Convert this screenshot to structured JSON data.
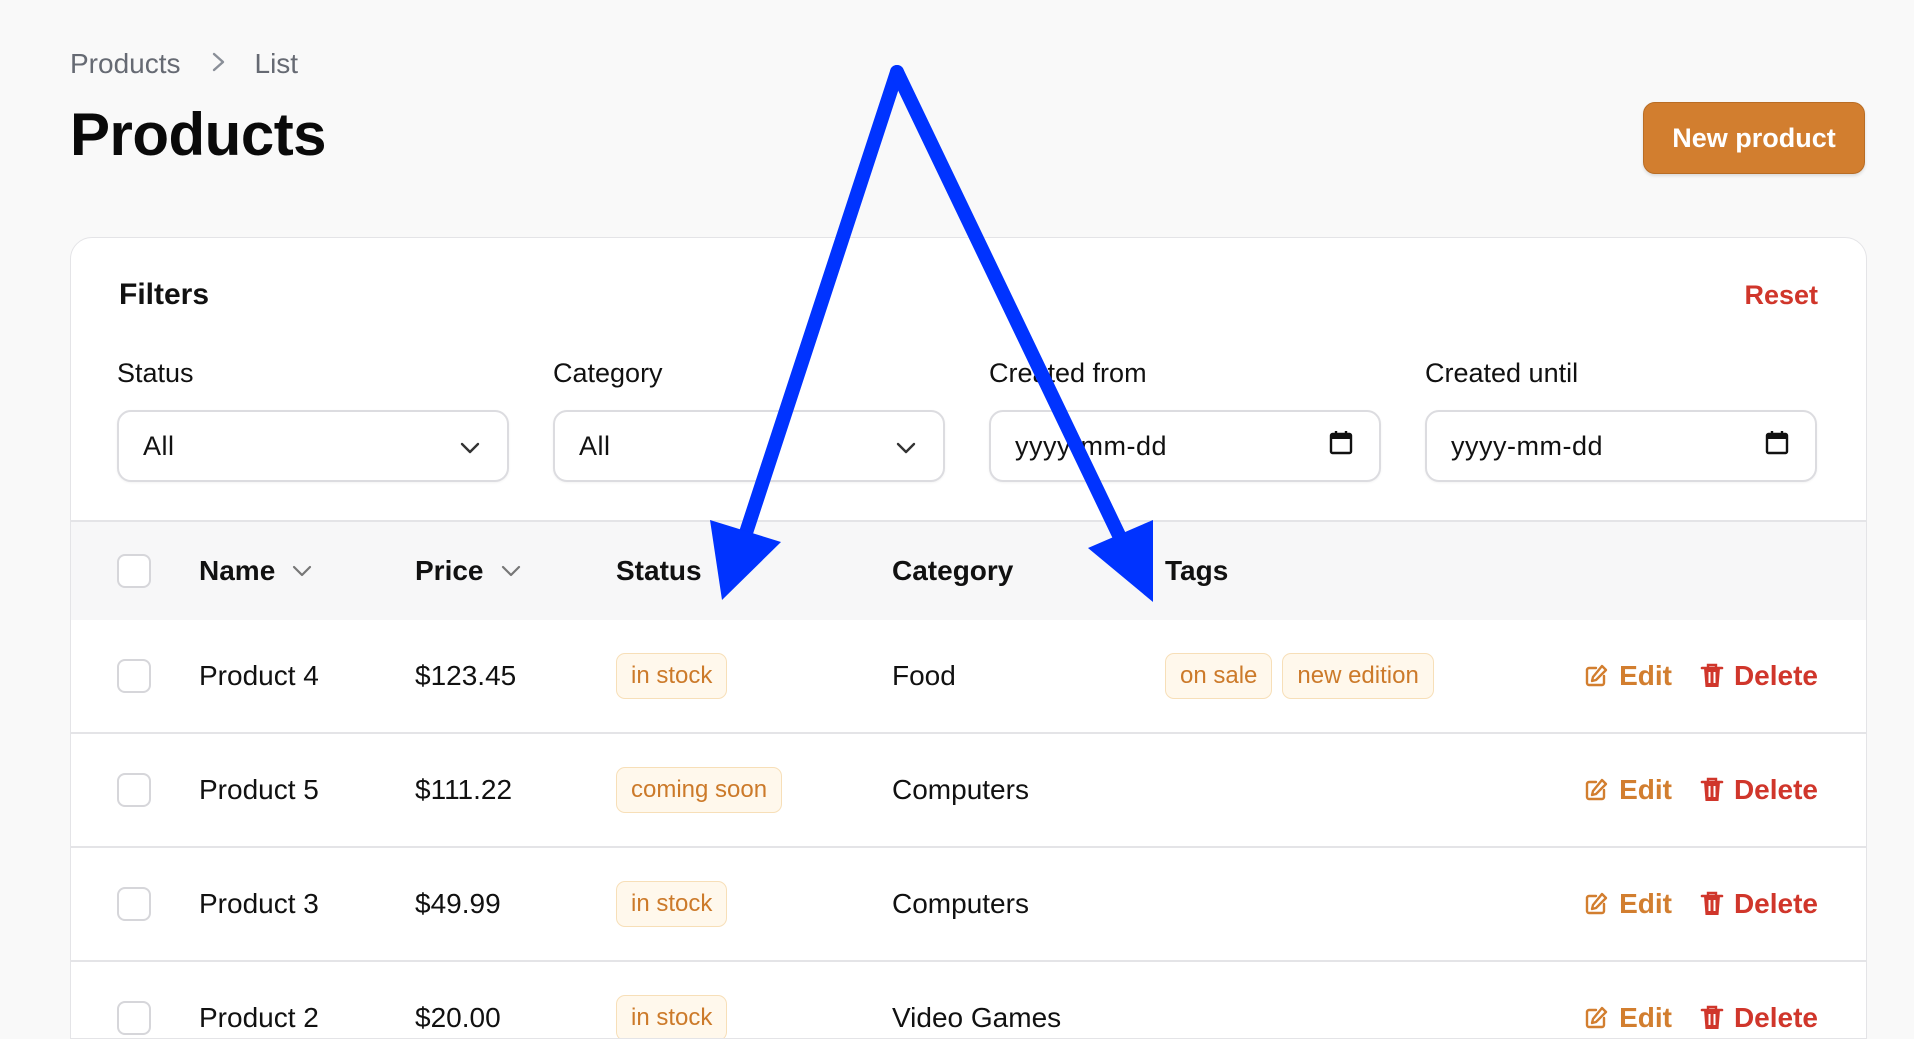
{
  "breadcrumb": {
    "items": [
      "Products",
      "List"
    ],
    "separator_icon": "chevron-right-icon"
  },
  "header": {
    "title": "Products",
    "new_button": "New product"
  },
  "filters": {
    "title": "Filters",
    "reset": "Reset",
    "fields": [
      {
        "label": "Status",
        "value": "All",
        "type": "select",
        "icon": "chevron-down-icon"
      },
      {
        "label": "Category",
        "value": "All",
        "type": "select",
        "icon": "chevron-down-icon"
      },
      {
        "label": "Created from",
        "value": "yyyy-mm-dd",
        "type": "date",
        "icon": "calendar-icon"
      },
      {
        "label": "Created until",
        "value": "yyyy-mm-dd",
        "type": "date",
        "icon": "calendar-icon"
      }
    ]
  },
  "table": {
    "columns": [
      "Name",
      "Price",
      "Status",
      "Category",
      "Tags"
    ],
    "sortable_columns": [
      "Name",
      "Price"
    ],
    "rows": [
      {
        "name": "Product 4",
        "price": "$123.45",
        "status": "in stock",
        "category": "Food",
        "tags": [
          "on sale",
          "new edition"
        ]
      },
      {
        "name": "Product 5",
        "price": "$111.22",
        "status": "coming soon",
        "category": "Computers",
        "tags": []
      },
      {
        "name": "Product 3",
        "price": "$49.99",
        "status": "in stock",
        "category": "Computers",
        "tags": []
      },
      {
        "name": "Product 2",
        "price": "$20.00",
        "status": "in stock",
        "category": "Video Games",
        "tags": []
      }
    ],
    "actions": {
      "edit": "Edit",
      "delete": "Delete",
      "edit_icon": "pencil-square-icon",
      "delete_icon": "trash-icon"
    }
  },
  "colors": {
    "accent": "#d27e2f",
    "danger": "#d0362b",
    "badge_bg": "#fff8ec",
    "badge_text": "#cc7a2a",
    "annotation_arrow": "#0033ff"
  }
}
